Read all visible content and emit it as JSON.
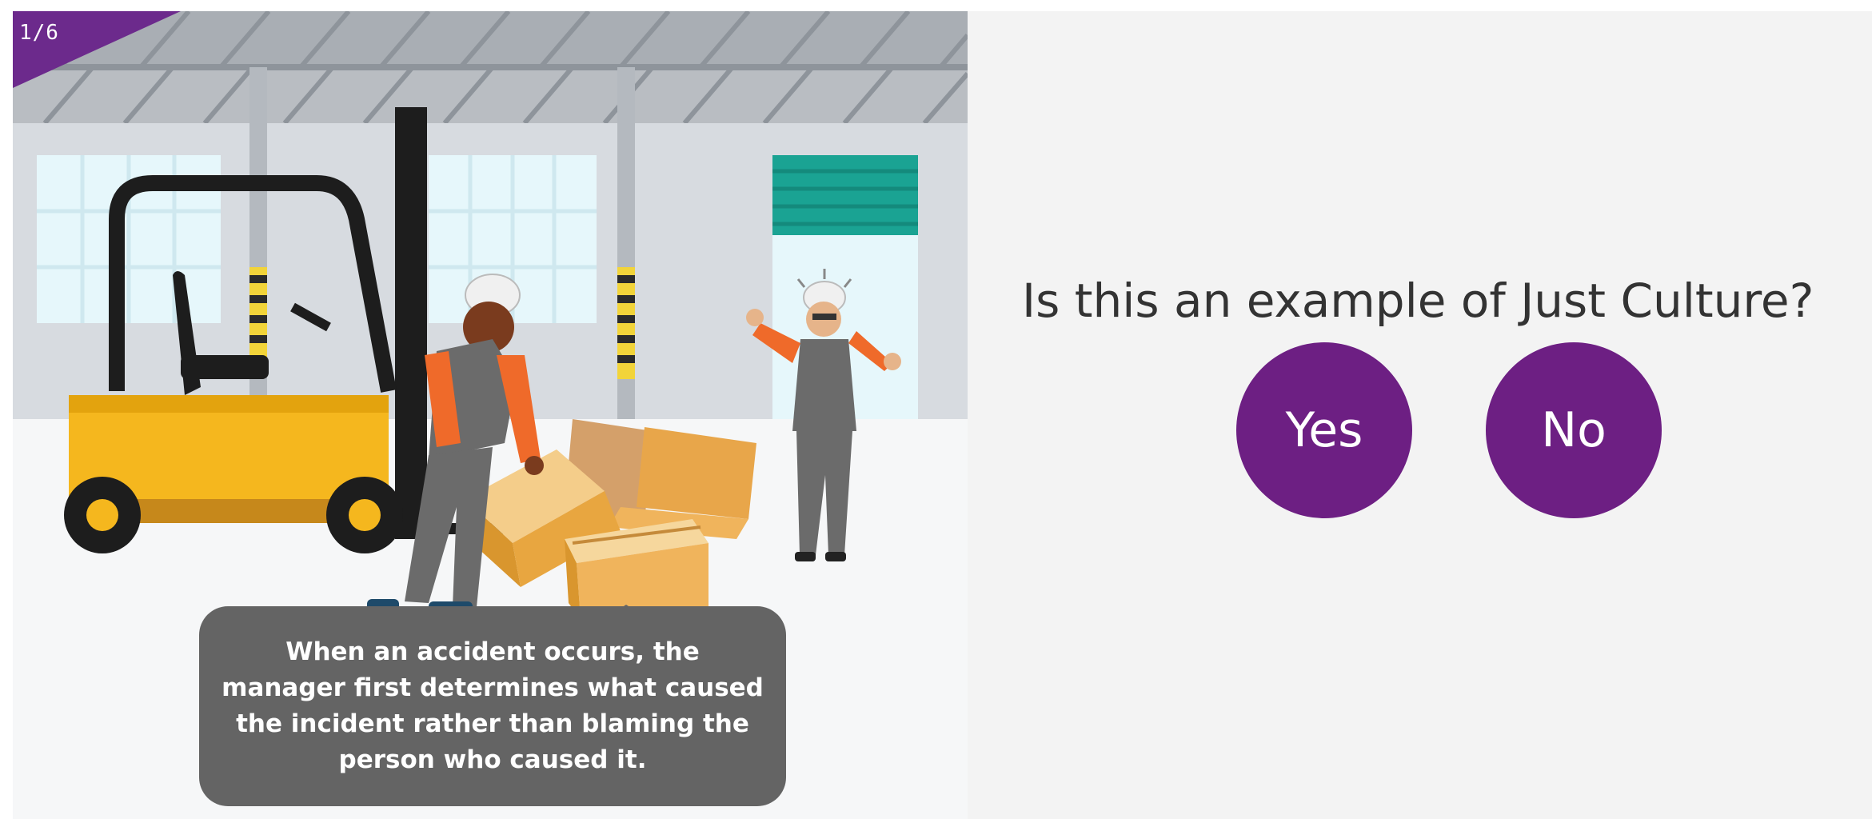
{
  "slide": {
    "counter": "1/6",
    "caption": "When an accident occurs, the manager first determines what caused the incident rather than blaming the person who caused it."
  },
  "quiz": {
    "question": "Is this an example of Just Culture?",
    "options": [
      "Yes",
      "No"
    ]
  },
  "colors": {
    "accent_purple": "#6d1f83",
    "badge_purple": "#6c2a8c",
    "caption_gray": "#646464",
    "panel_bg": "#f3f3f3"
  },
  "illustration": {
    "icons": [
      "forklift-icon",
      "worker-icon",
      "manager-icon",
      "cardboard-box-icon",
      "warehouse-door-icon"
    ]
  }
}
